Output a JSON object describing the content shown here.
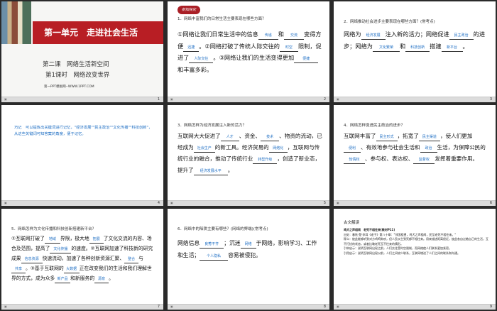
{
  "slide1": {
    "unit_title": "第一单元　走进社会生活",
    "lesson": "第二课　网络生活新空间",
    "section": "第1课时　网络改变世界",
    "credit": "第一PPT模板网--WWW.1PPT.COM",
    "num": "1"
  },
  "slide2": {
    "badge": "新知探究",
    "question": "1．网络丰富我们的日常生活主要表现在哪些方面？",
    "t1": "①网络让我们日常生活中的信息",
    "a1": "传递",
    "t2": "和",
    "a2": "交流",
    "t3": "变得方便",
    "a3": "迅捷",
    "t4": "。②网络打破了传统人际交往的",
    "a4": "时空",
    "t5": "限制，促进了",
    "a5": "人际交往",
    "t6": "。③网络让我们的生活变得更加",
    "a6": "便捷",
    "t7": "和丰富多彩。",
    "num": "2"
  },
  "slide3": {
    "question": "2．网络推动社会进步主要表现在哪些方面？(常考点)",
    "t1": "网络为",
    "a1": "经济发展",
    "t2": "注入新的活力；网络促进",
    "a2": "民主政治",
    "t3": "的进步；网络为",
    "a3": "文化繁荣",
    "t4": "和",
    "a4": "科技创新",
    "t5": "搭建",
    "a5": "新平台",
    "t6": "。",
    "num": "3"
  },
  "slide4": {
    "text": "巧记　可以提炼出关键词进行记忆，\"经济发展\"\"民主政治\"\"文化传播\"\"科技创新\"，从这些关键词可知答案的角度，便于记忆。",
    "num": "4"
  },
  "slide5": {
    "question": "3．网络怎样为经济发展注入新的活力？",
    "t1": "互联网大大促进了",
    "a1": "人才",
    "t2": "、资金、",
    "a2": "技术",
    "t3": "、物资的流动，已经成为",
    "a3": "社会生产",
    "t4": "的新工具。经济贸易的",
    "a4": "网络化",
    "t5": "，互联网与传统行业的融合，推动了传统行业",
    "a5": "转型升级",
    "t6": "，创造了新业态，提升了",
    "a6": "经济发展水平",
    "t7": "。",
    "num": "5"
  },
  "slide6": {
    "question": "4．网络怎样促进民主政治的进步？",
    "t1": "互联网丰富了",
    "a1": "民主形式",
    "t2": "，拓宽了",
    "a2": "民主渠道",
    "t3": "，使人们更加",
    "a3": "便利",
    "t4": "、有效地参与社会生活和",
    "a4": "政治",
    "t5": "生活，为保障公民的",
    "a5": "知情权",
    "t6": "、参与权、表达权、",
    "a6": "监督权",
    "t7": "发挥着重要作用。",
    "num": "6"
  },
  "slide7": {
    "question": "5．网络怎样为文化传播和科技创新搭建新平台？",
    "t1": "①互联网打破了",
    "a1": "地域",
    "t2": "界限，极大地",
    "a2": "拓展",
    "t3": "了文化交流的内容、场合及范围，提高了",
    "a3": "文化传播",
    "t4": "的速度。②互联网加速了科技新的研究成果",
    "a4": "信息资源",
    "t5": "快速流动，加速了各种创新资源汇聚、",
    "a5": "整合",
    "t6": "与",
    "a6": "共享",
    "t7": "。③基于互联网的",
    "a7": "大数据",
    "t8": "正在改变我们的生活和我们理解世界的方式，成为众多",
    "a8": "新产品",
    "t9": "和新服务的",
    "a9": "源泉",
    "t10": "。",
    "num": "7"
  },
  "slide8": {
    "question": "6．网络中的陷阱主要有哪些？(网络的弊端)(常考点)",
    "t1": "网络信息",
    "a1": "良莠不齐",
    "t2": "；沉迷",
    "a2": "网络",
    "t3": "于网络，影响学习、工作和生活；",
    "a3": "个人隐私",
    "t4": "容易被侵犯。",
    "num": "8"
  },
  "slide9": {
    "title": "古文解读",
    "l1": "鸡犬之声相闻　老死不相往来(教材P11)",
    "l2": "出处：春秋·楚·李耳《老子》第八十章：\"邻国相望，鸡犬之声相闻，民至老死不相往来。\"",
    "l3": "释义：彼此能够听到对方鸡鸣狗吠，但人民从生到死都不相往来。用来描述距离很近，彼此各自过着自己的生活，互不打扰的状态，或者比喻老死互不往来的情形。",
    "l4": "引申启示：说明互联网出现之前，人们交往受时空限制，而网络使人们联系更加紧密。",
    "l5": "引用启示：说明互联网出现以前，人们之间较少联系，互联网增进了人们之间的联系和沟通。",
    "num": "9"
  }
}
